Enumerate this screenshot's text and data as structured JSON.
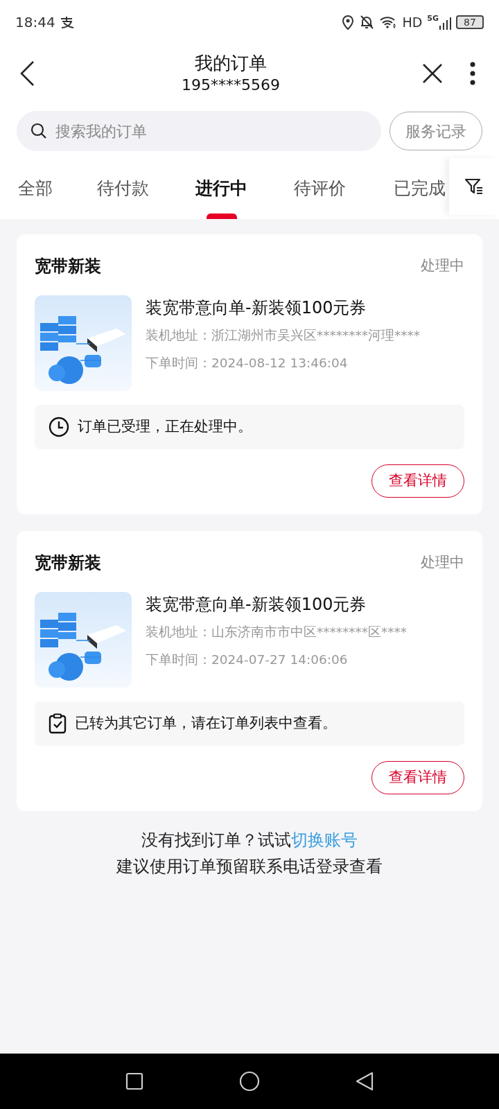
{
  "status_bar": {
    "time": "18:44",
    "network": "HD",
    "generation": "5G",
    "battery": "87"
  },
  "header": {
    "title": "我的订单",
    "subtitle": "195****5569"
  },
  "search": {
    "placeholder": "搜索我的订单",
    "button": "服务记录"
  },
  "tabs": [
    {
      "label": "全部",
      "selected": false
    },
    {
      "label": "待付款",
      "selected": false
    },
    {
      "label": "进行中",
      "selected": true
    },
    {
      "label": "待评价",
      "selected": false
    },
    {
      "label": "已完成",
      "selected": false
    }
  ],
  "orders": [
    {
      "category": "宽带新装",
      "status": "处理中",
      "name": "装宽带意向单-新装领100元券",
      "address": "装机地址：浙江湖州市吴兴区********河理****",
      "time": "下单时间：2024-08-12 13:46:04",
      "notice": {
        "kind": "clock",
        "text": "订单已受理，正在处理中。"
      },
      "button": "查看详情"
    },
    {
      "category": "宽带新装",
      "status": "处理中",
      "name": "装宽带意向单-新装领100元券",
      "address": "装机地址：山东济南市市中区********区****",
      "time": "下单时间：2024-07-27 14:06:06",
      "notice": {
        "kind": "clipboard",
        "text": "已转为其它订单，请在订单列表中查看。"
      },
      "button": "查看详情"
    }
  ],
  "footer": {
    "prompt": "没有找到订单？试试",
    "link": "切换账号",
    "hint": "建议使用订单预留联系电话登录查看"
  }
}
